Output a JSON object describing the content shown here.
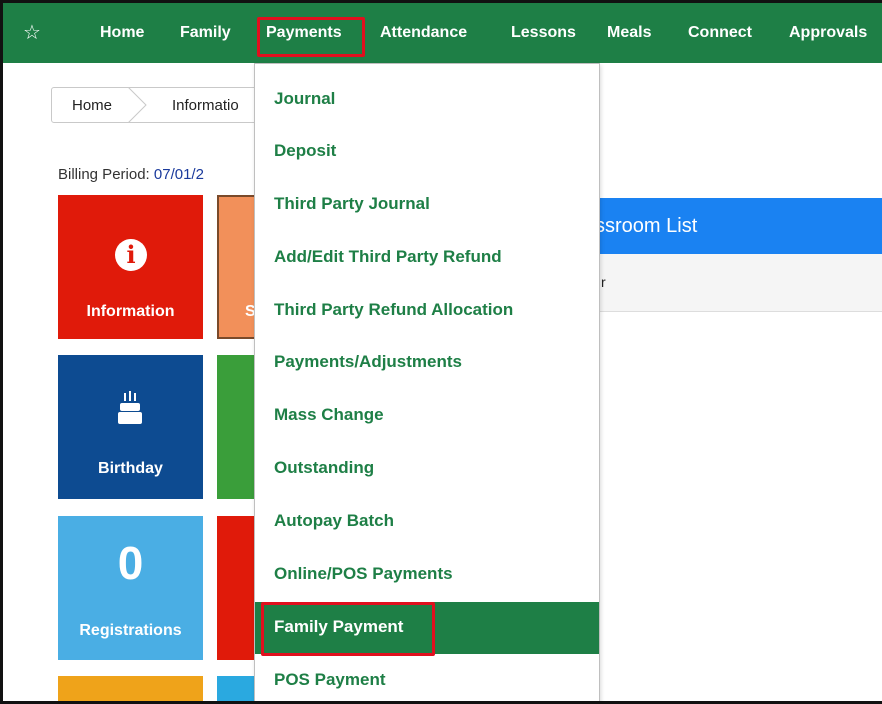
{
  "nav": {
    "items": [
      {
        "label": "Home"
      },
      {
        "label": "Family"
      },
      {
        "label": "Payments"
      },
      {
        "label": "Attendance"
      },
      {
        "label": "Lessons"
      },
      {
        "label": "Meals"
      },
      {
        "label": "Connect"
      },
      {
        "label": "Approvals"
      }
    ],
    "icon": "star-icon",
    "active": "Payments",
    "bar_color": "#1e7f46",
    "highlight_color": "#e0101e"
  },
  "breadcrumb": {
    "home": "Home",
    "current": "Informatio"
  },
  "billing": {
    "label": "Billing Period:",
    "value": "07/01/2"
  },
  "tiles": {
    "information": {
      "label": "Information",
      "icon": "info-icon",
      "color": "#e01a0a"
    },
    "orange_partial": {
      "label": "S",
      "color": "#f2905a"
    },
    "birthday": {
      "label": "Birthday",
      "icon": "birthday-cake-icon",
      "color": "#0d4b91"
    },
    "registrations": {
      "label": "Registrations",
      "count": "0",
      "color": "#4aaee4"
    }
  },
  "classroom": {
    "title": "ssroom List",
    "column": "r",
    "header_color": "#1a82f2"
  },
  "payments_menu": {
    "items": [
      {
        "label": "Journal"
      },
      {
        "label": "Deposit"
      },
      {
        "label": "Third Party Journal"
      },
      {
        "label": "Add/Edit Third Party Refund"
      },
      {
        "label": "Third Party Refund Allocation"
      },
      {
        "label": "Payments/Adjustments"
      },
      {
        "label": "Mass Change"
      },
      {
        "label": "Outstanding"
      },
      {
        "label": "Autopay Batch"
      },
      {
        "label": "Online/POS Payments"
      },
      {
        "label": "Family Payment"
      },
      {
        "label": "POS Payment"
      }
    ],
    "selected": "Family Payment",
    "text_color": "#1e7f46"
  }
}
